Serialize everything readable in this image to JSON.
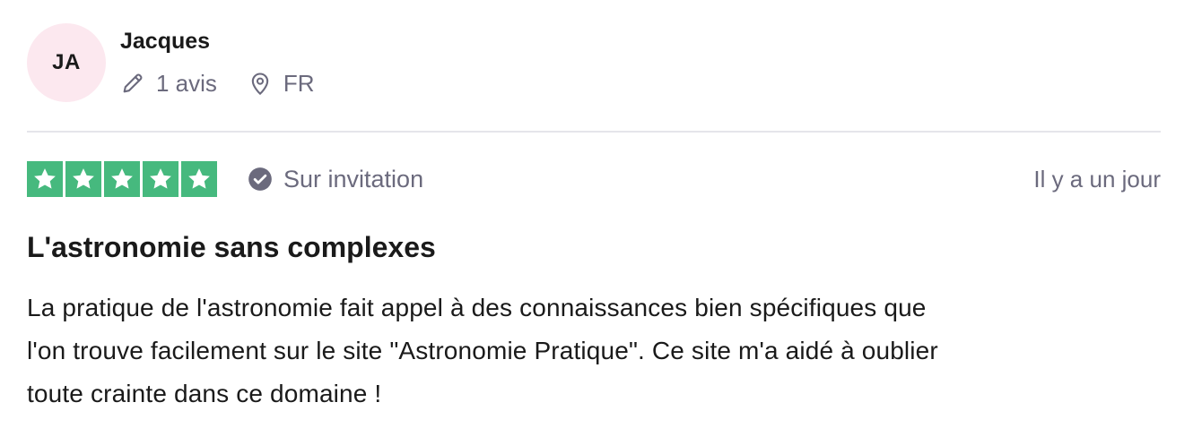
{
  "reviewer": {
    "initials": "JA",
    "name": "Jacques",
    "review_count": "1 avis",
    "country": "FR"
  },
  "rating": {
    "stars": 5,
    "max_stars": 5,
    "verification": "Sur invitation",
    "date": "Il y a un jour"
  },
  "review": {
    "title": "L'astronomie sans complexes",
    "lines": [
      "La pratique de l'astronomie fait appel à des connaissances bien spécifiques que",
      "l'on trouve facilement sur le site \"Astronomie Pratique\". Ce site m'a aidé à oublier",
      "toute crainte dans ce domaine !"
    ]
  },
  "colors": {
    "star_green": "#46b97e",
    "avatar_bg": "#fce8ef",
    "muted_text": "#6b6a7d"
  },
  "icons": {
    "review_count": "pencil-icon",
    "country": "location-pin-icon",
    "verification": "check-circle-icon",
    "star": "star-icon"
  }
}
